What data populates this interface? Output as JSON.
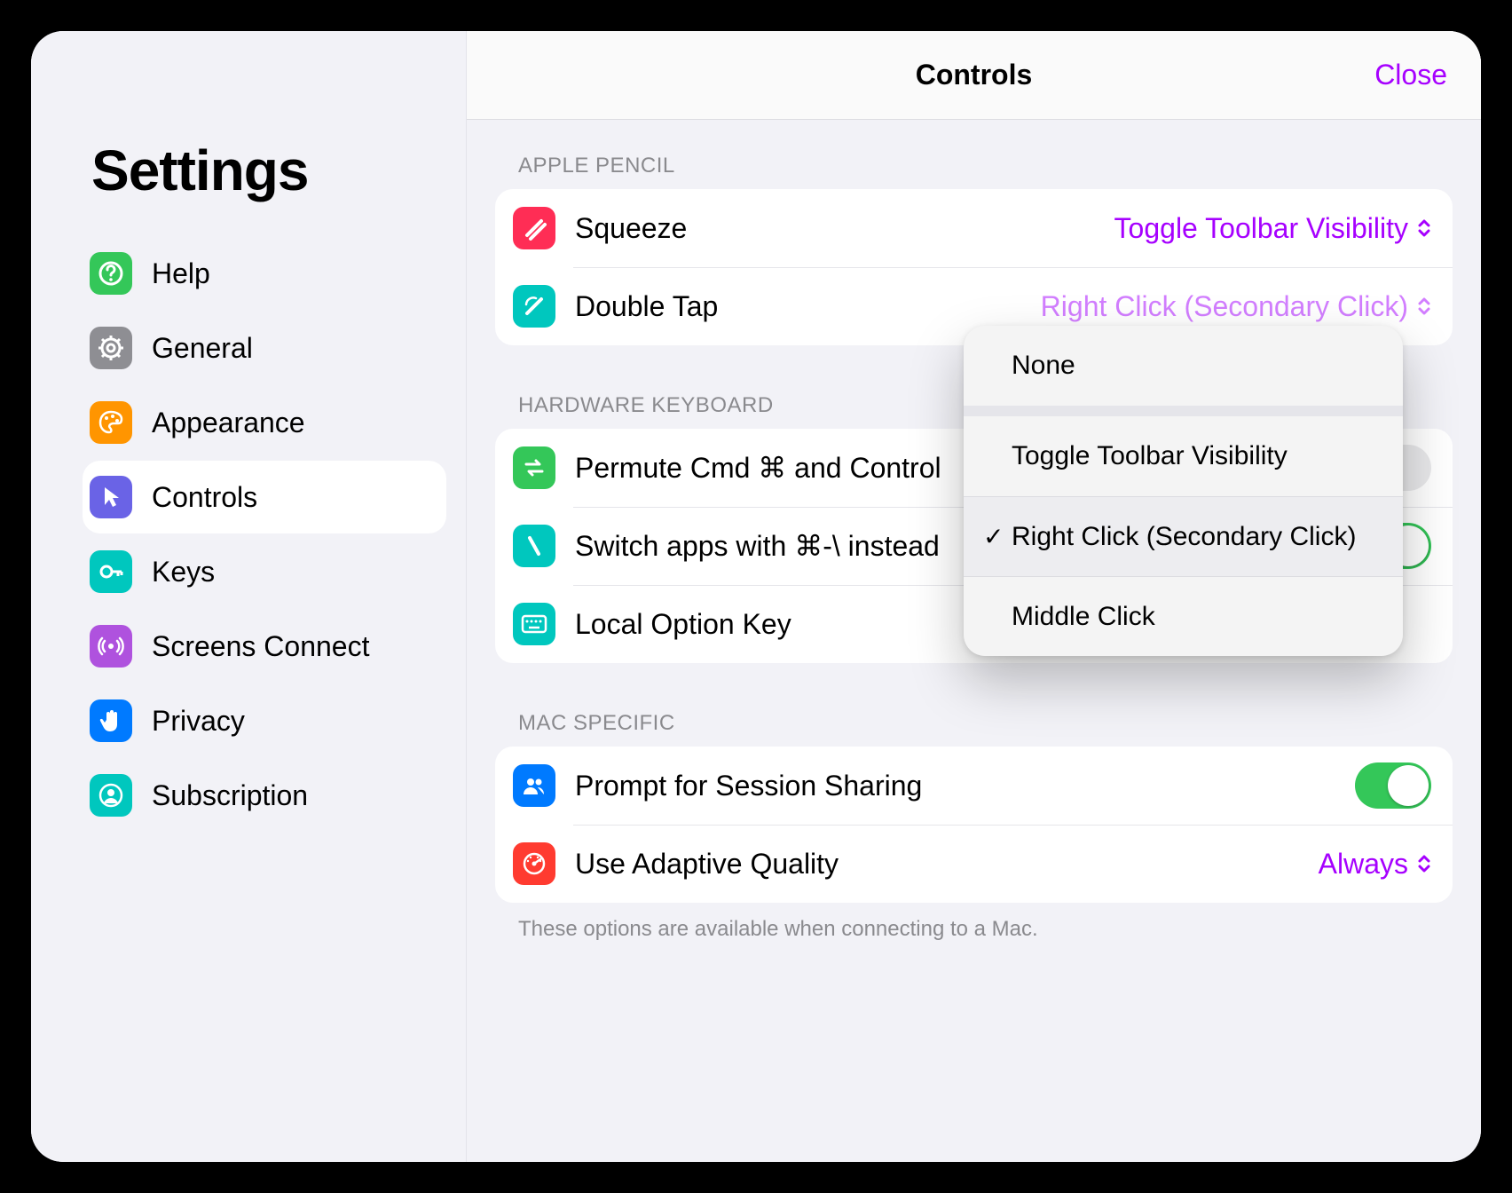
{
  "sidebar": {
    "title": "Settings",
    "items": [
      {
        "label": "Help",
        "icon": "help",
        "color": "#34c759"
      },
      {
        "label": "General",
        "icon": "gear",
        "color": "#8e8e93"
      },
      {
        "label": "Appearance",
        "icon": "palette",
        "color": "#ff9500"
      },
      {
        "label": "Controls",
        "icon": "cursor",
        "color": "#6a63e6",
        "active": true
      },
      {
        "label": "Keys",
        "icon": "key",
        "color": "#00c7be"
      },
      {
        "label": "Screens Connect",
        "icon": "broadcast",
        "color": "#af52de"
      },
      {
        "label": "Privacy",
        "icon": "hand",
        "color": "#007aff"
      },
      {
        "label": "Subscription",
        "icon": "person",
        "color": "#00c7be"
      }
    ]
  },
  "header": {
    "title": "Controls",
    "close": "Close"
  },
  "apple_pencil": {
    "section": "APPLE PENCIL",
    "squeeze_label": "Squeeze",
    "squeeze_value": "Toggle Toolbar Visibility",
    "doubletap_label": "Double Tap",
    "doubletap_value": "Right Click (Secondary Click)"
  },
  "hardware_keyboard": {
    "section": "HARDWARE KEYBOARD",
    "permute_label": "Permute Cmd ⌘ and Control",
    "switch_label": "Switch apps with ⌘-\\ instead",
    "local_option_label": "Local Option Key"
  },
  "mac_specific": {
    "section": "MAC SPECIFIC",
    "prompt_label": "Prompt for Session Sharing",
    "adaptive_label": "Use Adaptive Quality",
    "adaptive_value": "Always",
    "note": "These options are available when connecting to a Mac."
  },
  "popover": {
    "items": [
      {
        "label": "None",
        "selected": false
      },
      {
        "label": "Toggle Toolbar Visibility",
        "selected": false
      },
      {
        "label": "Right Click (Secondary Click)",
        "selected": true
      },
      {
        "label": "Middle Click",
        "selected": false
      }
    ]
  },
  "colors": {
    "accent": "#a600ff",
    "switch_on": "#34c759"
  }
}
